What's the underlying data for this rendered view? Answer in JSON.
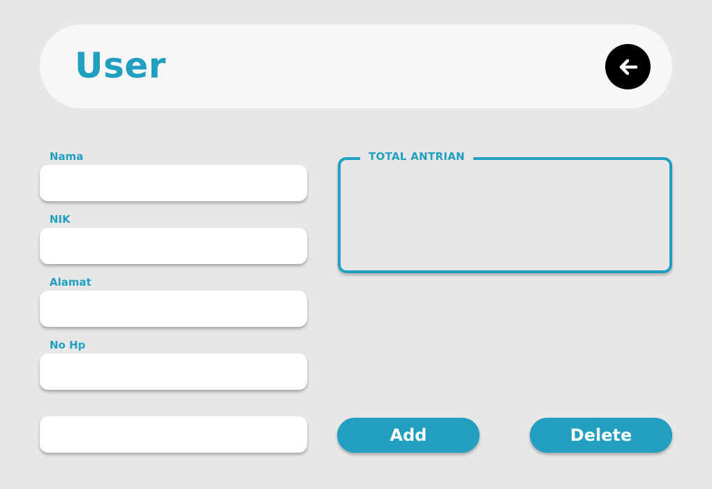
{
  "header": {
    "title": "User",
    "back_icon": "arrow-left-circle-icon"
  },
  "form": {
    "fields": [
      {
        "label": "Nama",
        "value": ""
      },
      {
        "label": "NIK",
        "value": ""
      },
      {
        "label": "Alamat",
        "value": ""
      },
      {
        "label": "No Hp",
        "value": ""
      }
    ],
    "extra_input_value": ""
  },
  "total_antrian": {
    "label": "TOTAL ANTRIAN",
    "value": ""
  },
  "actions": {
    "add_label": "Add",
    "delete_label": "Delete"
  },
  "colors": {
    "accent": "#209fc0",
    "background": "#e7e7e7",
    "header_bg": "#f7f7f7"
  }
}
